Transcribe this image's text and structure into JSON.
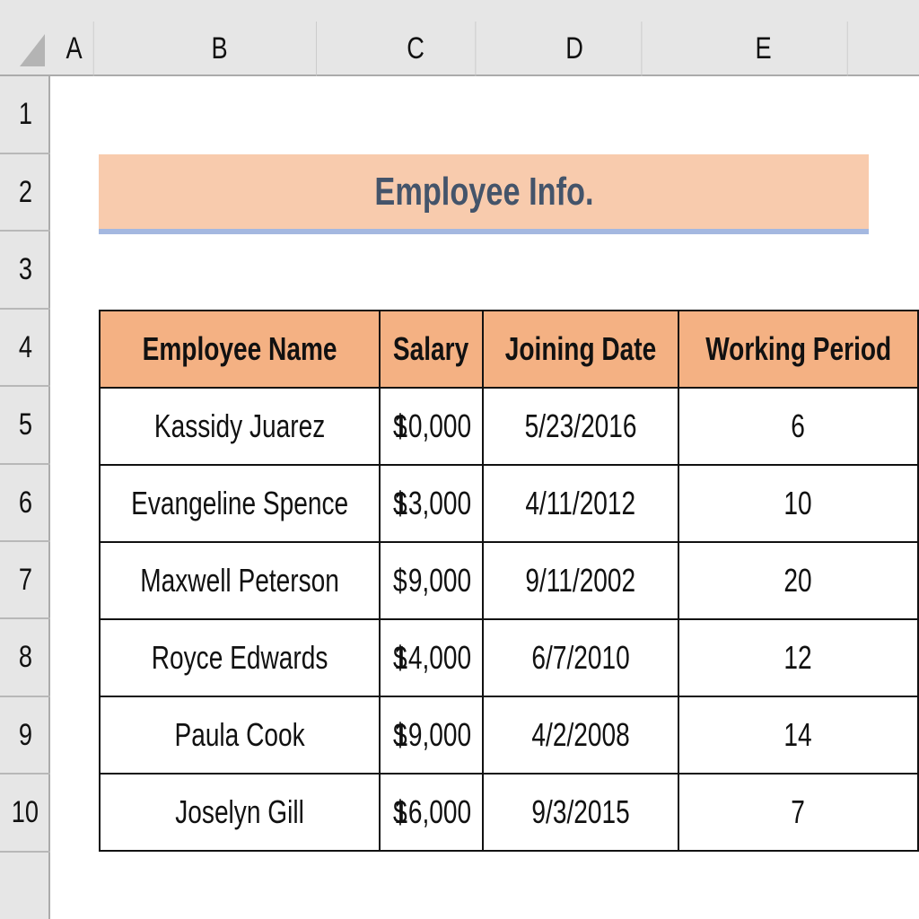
{
  "sheet": {
    "columns": [
      "A",
      "B",
      "C",
      "D",
      "E"
    ],
    "rows": [
      "1",
      "2",
      "3",
      "4",
      "5",
      "6",
      "7",
      "8",
      "9",
      "10"
    ]
  },
  "title": "Employee Info.",
  "colors": {
    "title_fill": "#f8cbad",
    "title_text": "#44546a",
    "title_underline": "#a4b8e0",
    "header_fill": "#f4b183"
  },
  "table": {
    "headers": [
      "Employee Name",
      "Salary",
      "Joining Date",
      "Working Period"
    ],
    "rows": [
      {
        "name": "Kassidy Juarez",
        "currency": "$",
        "salary": "10,000",
        "date": "5/23/2016",
        "period": "6"
      },
      {
        "name": "Evangeline Spence",
        "currency": "$",
        "salary": "13,000",
        "date": "4/11/2012",
        "period": "10"
      },
      {
        "name": "Maxwell Peterson",
        "currency": "$",
        "salary": "9,000",
        "date": "9/11/2002",
        "period": "20"
      },
      {
        "name": "Royce Edwards",
        "currency": "$",
        "salary": "14,000",
        "date": "6/7/2010",
        "period": "12"
      },
      {
        "name": "Paula Cook",
        "currency": "$",
        "salary": "19,000",
        "date": "4/2/2008",
        "period": "14"
      },
      {
        "name": "Joselyn Gill",
        "currency": "$",
        "salary": "16,000",
        "date": "9/3/2015",
        "period": "7"
      }
    ]
  }
}
